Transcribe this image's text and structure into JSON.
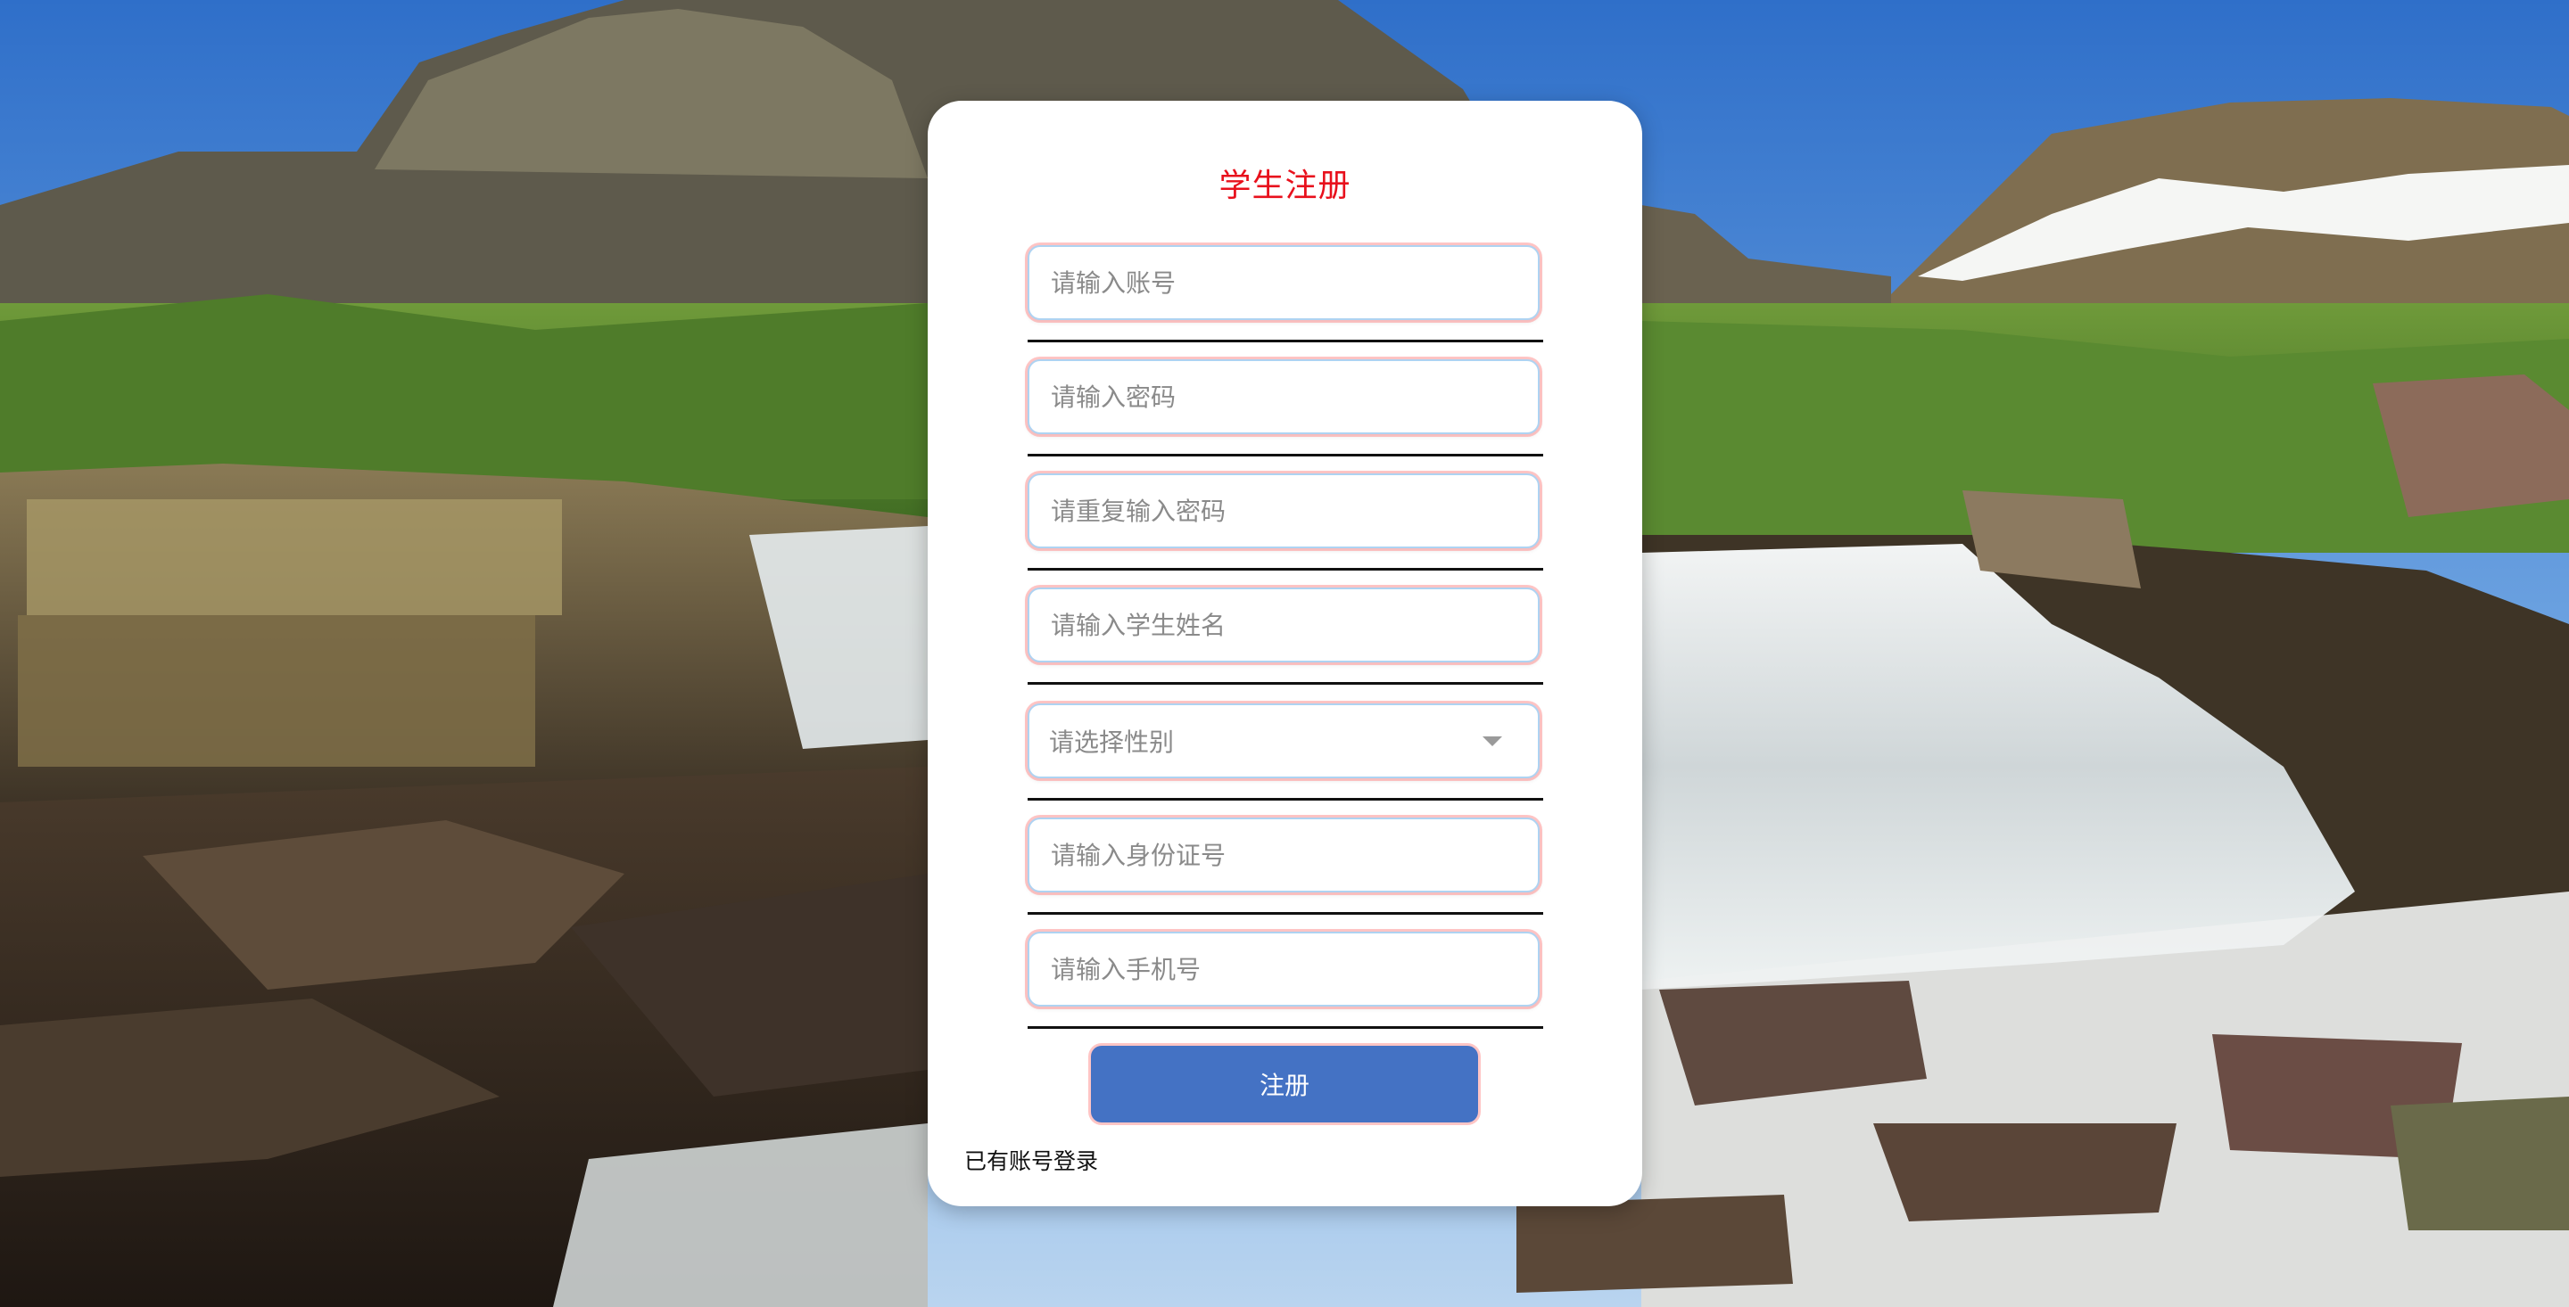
{
  "form": {
    "title": "学生注册",
    "fields": [
      {
        "type": "input",
        "placeholder": "请输入账号",
        "value": ""
      },
      {
        "type": "input",
        "placeholder": "请输入密码",
        "value": ""
      },
      {
        "type": "input",
        "placeholder": "请重复输入密码",
        "value": ""
      },
      {
        "type": "input",
        "placeholder": "请输入学生姓名",
        "value": ""
      },
      {
        "type": "select",
        "placeholder": "请选择性别",
        "value": ""
      },
      {
        "type": "input",
        "placeholder": "请输入身份证号",
        "value": ""
      },
      {
        "type": "input",
        "placeholder": "请输入手机号",
        "value": ""
      }
    ],
    "submit_label": "注册",
    "login_link": "已有账号登录"
  },
  "icons": {
    "select_caret": "chevron-down-icon"
  },
  "colors": {
    "title": "#e8101c",
    "button": "#4472c4",
    "field_border": "#aed3f2"
  }
}
